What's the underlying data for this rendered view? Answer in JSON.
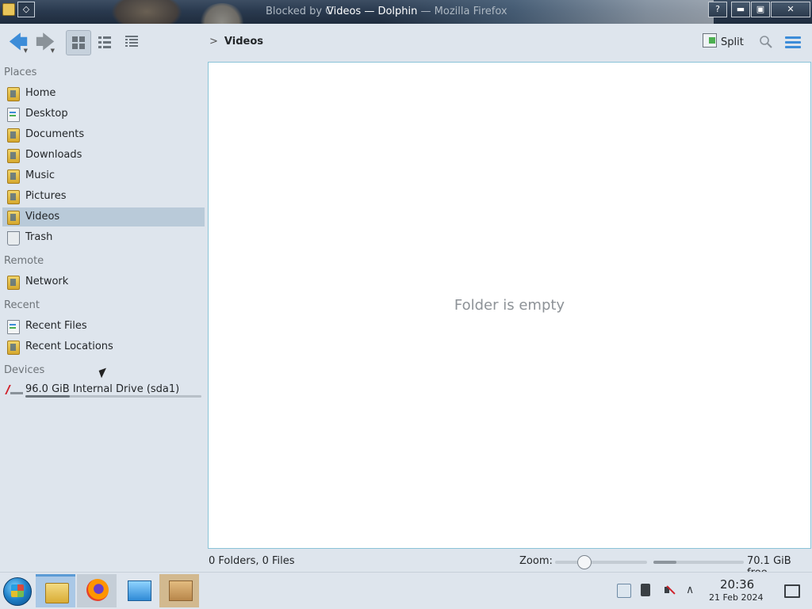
{
  "window": {
    "title_back": "Blocked by C",
    "title": "Videos — Dolphin",
    "title_tail": "— Mozilla Firefox",
    "help_icon": "?",
    "min_icon": "▬",
    "max_icon": "▣",
    "close_icon": "✕"
  },
  "toolbar": {
    "back_icon": "🡄",
    "forward_icon": "🡆",
    "breadcrumb": [
      "Videos"
    ],
    "split_label": "Split"
  },
  "sidebar": {
    "sections": [
      {
        "header": "Places",
        "items": [
          {
            "label": "Home",
            "icon": "folder-home-icon"
          },
          {
            "label": "Desktop",
            "icon": "desktop-icon"
          },
          {
            "label": "Documents",
            "icon": "folder-documents-icon"
          },
          {
            "label": "Downloads",
            "icon": "folder-downloads-icon"
          },
          {
            "label": "Music",
            "icon": "folder-music-icon"
          },
          {
            "label": "Pictures",
            "icon": "folder-pictures-icon"
          },
          {
            "label": "Videos",
            "icon": "folder-videos-icon",
            "selected": true
          },
          {
            "label": "Trash",
            "icon": "trash-icon"
          }
        ]
      },
      {
        "header": "Remote",
        "items": [
          {
            "label": "Network",
            "icon": "folder-network-icon"
          }
        ]
      },
      {
        "header": "Recent",
        "items": [
          {
            "label": "Recent Files",
            "icon": "recent-files-icon"
          },
          {
            "label": "Recent Locations",
            "icon": "recent-locations-icon"
          }
        ]
      },
      {
        "header": "Devices",
        "items": [
          {
            "label": "96.0 GiB Internal Drive (sda1)",
            "icon": "drive-icon",
            "usage_fraction": 0.25
          }
        ]
      }
    ]
  },
  "main": {
    "empty_message": "Folder is empty"
  },
  "statusbar": {
    "counts": "0 Folders, 0 Files",
    "zoom_label": "Zoom:",
    "zoom_fraction": 0.28,
    "free_space": "70.1 GiB free",
    "free_fraction": 0.25
  },
  "taskbar": {
    "clock_time": "20:36",
    "clock_date": "21 Feb 2024",
    "expand_icon": "∧"
  },
  "colors": {
    "accent": "#3c8cd8",
    "selection": "#b9cad9",
    "view_border": "#8ac3d7"
  }
}
